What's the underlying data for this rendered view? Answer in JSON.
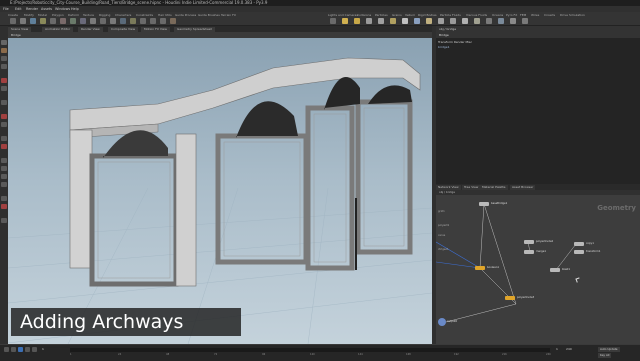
{
  "window": {
    "title": "E:/Projects/Roboticcity_City-Course_Building/Road_Tiers/Bridge_scene.hipnc - Houdini Indie Limited-Commercial 19.0.383 - Py3.9"
  },
  "menu": [
    "File",
    "Edit",
    "Render",
    "Assets",
    "Windows",
    "Help",
    "Assets",
    "Build",
    "Digital"
  ],
  "shelf": {
    "tabs": [
      "Create",
      "Modify",
      "Model",
      "Polygon",
      "Deform",
      "Texture",
      "Rigging",
      "Characters",
      "Constraints",
      "Hair Utils",
      "Guide Process",
      "Guide Brushes",
      "Terrain FX"
    ],
    "right_tabs": [
      "Lights and Cameras",
      "Collisions",
      "Particles",
      "Grains",
      "Vellum",
      "Rigid Bodies",
      "Particle Fluids",
      "Viscous Fluids",
      "Oceans",
      "Pyro FX",
      "FEM",
      "Wires",
      "Crowds",
      "Drive Simulation"
    ]
  },
  "viewport": {
    "tabs": [
      "Scene View",
      "Animation Editor",
      "Render View",
      "Composite View",
      "Motion FX View",
      "Geometry Spreadsheet"
    ],
    "path": "obj",
    "node": "Bridge",
    "header_label": "Bridge"
  },
  "param_panel": {
    "path": "obj / bridge",
    "node_label": "Bridge",
    "rows": [
      "Transform  Render  Misc",
      "bridge1"
    ]
  },
  "network": {
    "tabs": [
      "Network View",
      "Tree View",
      "Material Palette",
      "Asset Browser"
    ],
    "path": "obj / bridge",
    "context_label": "Geometry",
    "nodes": [
      {
        "label": "baseBridge1",
        "color": "#b9b9b9"
      },
      {
        "label": "merge1",
        "color": "#b9b9b9"
      },
      {
        "label": "polyextrude2",
        "color": "#b9b9b9"
      },
      {
        "label": "copy1",
        "color": "#b9b9b9"
      },
      {
        "label": "transform1",
        "color": "#b9b9b9"
      },
      {
        "label": "blast1",
        "color": "#b9b9b9"
      },
      {
        "label": "boolean1",
        "color": "#e0a52a"
      },
      {
        "label": "polyextrude3",
        "color": "#e0a52a"
      },
      {
        "label": "output0",
        "color": "#d7d7d7"
      }
    ],
    "side_labels": [
      "grid1",
      "polyext1",
      "carve",
      "ctrlgeo1"
    ]
  },
  "timeline": {
    "start": "1",
    "end": "240",
    "current": "1",
    "ticks": [
      "1",
      "24",
      "48",
      "72",
      "96",
      "120",
      "144",
      "168",
      "192",
      "216",
      "240"
    ],
    "buttons": [
      "Auto Update",
      "Key All"
    ]
  },
  "caption": {
    "text": "Adding Archways"
  },
  "colors": {
    "accent": "#e0a52a",
    "play": "#3b6fb5",
    "sky_top": "#8aa1b2",
    "sky_bottom": "#c4d2db"
  }
}
